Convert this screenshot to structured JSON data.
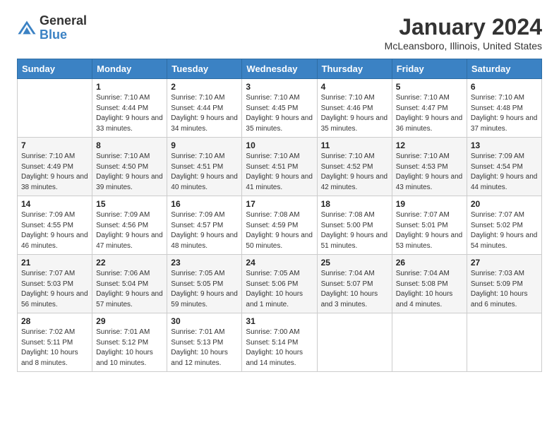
{
  "logo": {
    "general": "General",
    "blue": "Blue"
  },
  "title": "January 2024",
  "subtitle": "McLeansboro, Illinois, United States",
  "days_of_week": [
    "Sunday",
    "Monday",
    "Tuesday",
    "Wednesday",
    "Thursday",
    "Friday",
    "Saturday"
  ],
  "weeks": [
    [
      {
        "day": "",
        "empty": true
      },
      {
        "day": "1",
        "sunrise": "Sunrise: 7:10 AM",
        "sunset": "Sunset: 4:44 PM",
        "daylight": "Daylight: 9 hours and 33 minutes."
      },
      {
        "day": "2",
        "sunrise": "Sunrise: 7:10 AM",
        "sunset": "Sunset: 4:44 PM",
        "daylight": "Daylight: 9 hours and 34 minutes."
      },
      {
        "day": "3",
        "sunrise": "Sunrise: 7:10 AM",
        "sunset": "Sunset: 4:45 PM",
        "daylight": "Daylight: 9 hours and 35 minutes."
      },
      {
        "day": "4",
        "sunrise": "Sunrise: 7:10 AM",
        "sunset": "Sunset: 4:46 PM",
        "daylight": "Daylight: 9 hours and 35 minutes."
      },
      {
        "day": "5",
        "sunrise": "Sunrise: 7:10 AM",
        "sunset": "Sunset: 4:47 PM",
        "daylight": "Daylight: 9 hours and 36 minutes."
      },
      {
        "day": "6",
        "sunrise": "Sunrise: 7:10 AM",
        "sunset": "Sunset: 4:48 PM",
        "daylight": "Daylight: 9 hours and 37 minutes."
      }
    ],
    [
      {
        "day": "7",
        "sunrise": "Sunrise: 7:10 AM",
        "sunset": "Sunset: 4:49 PM",
        "daylight": "Daylight: 9 hours and 38 minutes."
      },
      {
        "day": "8",
        "sunrise": "Sunrise: 7:10 AM",
        "sunset": "Sunset: 4:50 PM",
        "daylight": "Daylight: 9 hours and 39 minutes."
      },
      {
        "day": "9",
        "sunrise": "Sunrise: 7:10 AM",
        "sunset": "Sunset: 4:51 PM",
        "daylight": "Daylight: 9 hours and 40 minutes."
      },
      {
        "day": "10",
        "sunrise": "Sunrise: 7:10 AM",
        "sunset": "Sunset: 4:51 PM",
        "daylight": "Daylight: 9 hours and 41 minutes."
      },
      {
        "day": "11",
        "sunrise": "Sunrise: 7:10 AM",
        "sunset": "Sunset: 4:52 PM",
        "daylight": "Daylight: 9 hours and 42 minutes."
      },
      {
        "day": "12",
        "sunrise": "Sunrise: 7:10 AM",
        "sunset": "Sunset: 4:53 PM",
        "daylight": "Daylight: 9 hours and 43 minutes."
      },
      {
        "day": "13",
        "sunrise": "Sunrise: 7:09 AM",
        "sunset": "Sunset: 4:54 PM",
        "daylight": "Daylight: 9 hours and 44 minutes."
      }
    ],
    [
      {
        "day": "14",
        "sunrise": "Sunrise: 7:09 AM",
        "sunset": "Sunset: 4:55 PM",
        "daylight": "Daylight: 9 hours and 46 minutes."
      },
      {
        "day": "15",
        "sunrise": "Sunrise: 7:09 AM",
        "sunset": "Sunset: 4:56 PM",
        "daylight": "Daylight: 9 hours and 47 minutes."
      },
      {
        "day": "16",
        "sunrise": "Sunrise: 7:09 AM",
        "sunset": "Sunset: 4:57 PM",
        "daylight": "Daylight: 9 hours and 48 minutes."
      },
      {
        "day": "17",
        "sunrise": "Sunrise: 7:08 AM",
        "sunset": "Sunset: 4:59 PM",
        "daylight": "Daylight: 9 hours and 50 minutes."
      },
      {
        "day": "18",
        "sunrise": "Sunrise: 7:08 AM",
        "sunset": "Sunset: 5:00 PM",
        "daylight": "Daylight: 9 hours and 51 minutes."
      },
      {
        "day": "19",
        "sunrise": "Sunrise: 7:07 AM",
        "sunset": "Sunset: 5:01 PM",
        "daylight": "Daylight: 9 hours and 53 minutes."
      },
      {
        "day": "20",
        "sunrise": "Sunrise: 7:07 AM",
        "sunset": "Sunset: 5:02 PM",
        "daylight": "Daylight: 9 hours and 54 minutes."
      }
    ],
    [
      {
        "day": "21",
        "sunrise": "Sunrise: 7:07 AM",
        "sunset": "Sunset: 5:03 PM",
        "daylight": "Daylight: 9 hours and 56 minutes."
      },
      {
        "day": "22",
        "sunrise": "Sunrise: 7:06 AM",
        "sunset": "Sunset: 5:04 PM",
        "daylight": "Daylight: 9 hours and 57 minutes."
      },
      {
        "day": "23",
        "sunrise": "Sunrise: 7:05 AM",
        "sunset": "Sunset: 5:05 PM",
        "daylight": "Daylight: 9 hours and 59 minutes."
      },
      {
        "day": "24",
        "sunrise": "Sunrise: 7:05 AM",
        "sunset": "Sunset: 5:06 PM",
        "daylight": "Daylight: 10 hours and 1 minute."
      },
      {
        "day": "25",
        "sunrise": "Sunrise: 7:04 AM",
        "sunset": "Sunset: 5:07 PM",
        "daylight": "Daylight: 10 hours and 3 minutes."
      },
      {
        "day": "26",
        "sunrise": "Sunrise: 7:04 AM",
        "sunset": "Sunset: 5:08 PM",
        "daylight": "Daylight: 10 hours and 4 minutes."
      },
      {
        "day": "27",
        "sunrise": "Sunrise: 7:03 AM",
        "sunset": "Sunset: 5:09 PM",
        "daylight": "Daylight: 10 hours and 6 minutes."
      }
    ],
    [
      {
        "day": "28",
        "sunrise": "Sunrise: 7:02 AM",
        "sunset": "Sunset: 5:11 PM",
        "daylight": "Daylight: 10 hours and 8 minutes."
      },
      {
        "day": "29",
        "sunrise": "Sunrise: 7:01 AM",
        "sunset": "Sunset: 5:12 PM",
        "daylight": "Daylight: 10 hours and 10 minutes."
      },
      {
        "day": "30",
        "sunrise": "Sunrise: 7:01 AM",
        "sunset": "Sunset: 5:13 PM",
        "daylight": "Daylight: 10 hours and 12 minutes."
      },
      {
        "day": "31",
        "sunrise": "Sunrise: 7:00 AM",
        "sunset": "Sunset: 5:14 PM",
        "daylight": "Daylight: 10 hours and 14 minutes."
      },
      {
        "day": "",
        "empty": true
      },
      {
        "day": "",
        "empty": true
      },
      {
        "day": "",
        "empty": true
      }
    ]
  ]
}
